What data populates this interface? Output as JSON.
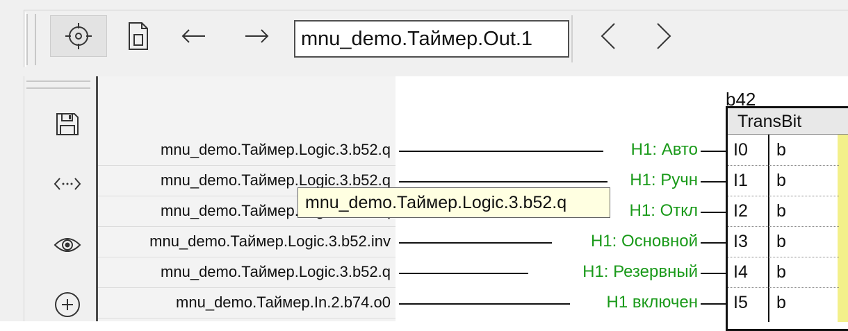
{
  "toolbar": {
    "address": "mnu_demo.Таймер.Out.1",
    "icons": [
      "target-icon",
      "document-icon",
      "arrow-left-icon",
      "arrow-right-icon",
      "chevron-left-icon",
      "chevron-right-icon"
    ]
  },
  "side_toolbar": {
    "icons": [
      "save-icon",
      "code-brackets-icon",
      "eye-icon",
      "plus-circle-icon"
    ]
  },
  "block": {
    "name": "b42",
    "type": "TransBit",
    "pins": [
      {
        "name": "I0",
        "type": "b"
      },
      {
        "name": "I1",
        "type": "b"
      },
      {
        "name": "I2",
        "type": "b"
      },
      {
        "name": "I3",
        "type": "b"
      },
      {
        "name": "I4",
        "type": "b"
      },
      {
        "name": "I5",
        "type": "b"
      }
    ]
  },
  "signals": [
    {
      "source": "mnu_demo.Таймер.Logic.3.b52.q",
      "label": "Н1: Авто"
    },
    {
      "source": "mnu_demo.Таймер.Logic.3.b52.q",
      "label": "Н1: Ручн"
    },
    {
      "source": "mnu_demo.Таймер.Logic.3.b52.q",
      "label": "Н1: Откл"
    },
    {
      "source": "mnu_demo.Таймер.Logic.3.b52.inv",
      "label": "Н1: Основной"
    },
    {
      "source": "mnu_demo.Таймер.Logic.3.b52.q",
      "label": "Н1: Резервный"
    },
    {
      "source": "mnu_demo.Таймер.In.2.b74.o0",
      "label": "Н1 включен"
    }
  ],
  "tooltip": "mnu_demo.Таймер.Logic.3.b52.q",
  "colors": {
    "label_green": "#1a9a1a",
    "tooltip_bg": "#ffffe1",
    "pin_highlight": "#f3f08a"
  }
}
